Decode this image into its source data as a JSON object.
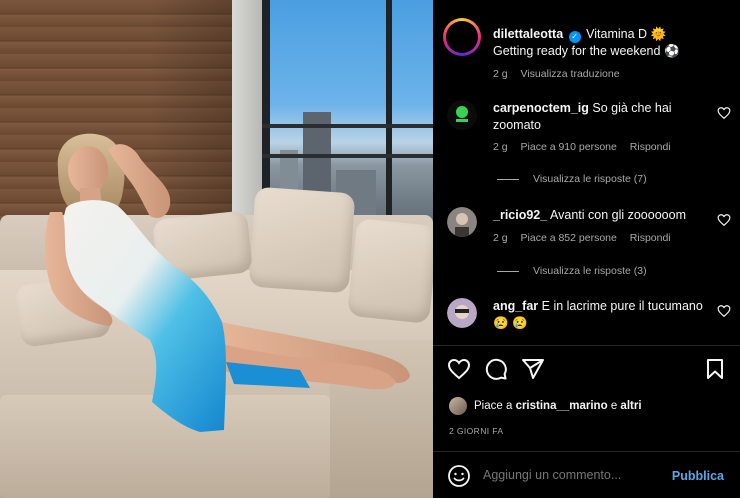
{
  "post": {
    "username": "dilettaleotta",
    "caption_line1": "Vitamina D",
    "caption_line2": "Getting ready for the weekend",
    "emoji_sun": "🌞",
    "emoji_ball": "⚽",
    "time_ago": "2 g",
    "translate_label": "Visualizza traduzione"
  },
  "comments": [
    {
      "username": "carpenoctem_ig",
      "text": "So già che hai zoomato",
      "time": "2 g",
      "likes": "Piace a 910 persone",
      "reply_label": "Rispondi",
      "view_replies": "Visualizza le risposte (7)"
    },
    {
      "username": "_ricio92_",
      "text": "Avanti con gli zoooooom",
      "time": "2 g",
      "likes": "Piace a 852 persone",
      "reply_label": "Rispondi",
      "view_replies": "Visualizza le risposte (3)"
    },
    {
      "username": "ang_far",
      "text": "E in lacrime pure il tucumano 😢 😢"
    }
  ],
  "likes_summary": {
    "prefix": "Piace a",
    "user": "cristina__marino",
    "conjunction": "e",
    "others": "altri"
  },
  "timestamp": "2 GIORNI FA",
  "add_comment": {
    "placeholder": "Aggiungi un commento...",
    "publish_label": "Pubblica"
  },
  "colors": {
    "background": "#000000",
    "text": "#f5f5f5",
    "muted": "#a8a8a8",
    "link": "#5aa7e8",
    "verified": "#0095f6"
  },
  "icons": [
    "heart-icon",
    "comment-icon",
    "share-icon",
    "bookmark-icon",
    "emoji-icon",
    "verified-icon"
  ]
}
